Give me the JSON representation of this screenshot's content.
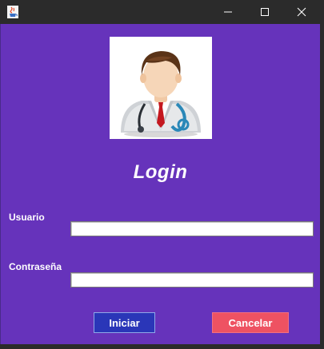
{
  "window": {
    "title": "",
    "controls": [
      "minimize-icon",
      "maximize-icon",
      "close-icon"
    ],
    "app_icon": "java-cup-icon"
  },
  "form": {
    "title": "Login",
    "avatar_icon": "doctor-avatar-icon",
    "username_label": "Usuario",
    "username_value": "",
    "password_label": "Contraseña",
    "password_value": "",
    "start_button": "Iniciar",
    "cancel_button": "Cancelar"
  },
  "colors": {
    "background": "#6633bb",
    "start_button": "#2a36b8",
    "cancel_button": "#ee5262",
    "titlebar": "#2b2b2b"
  }
}
